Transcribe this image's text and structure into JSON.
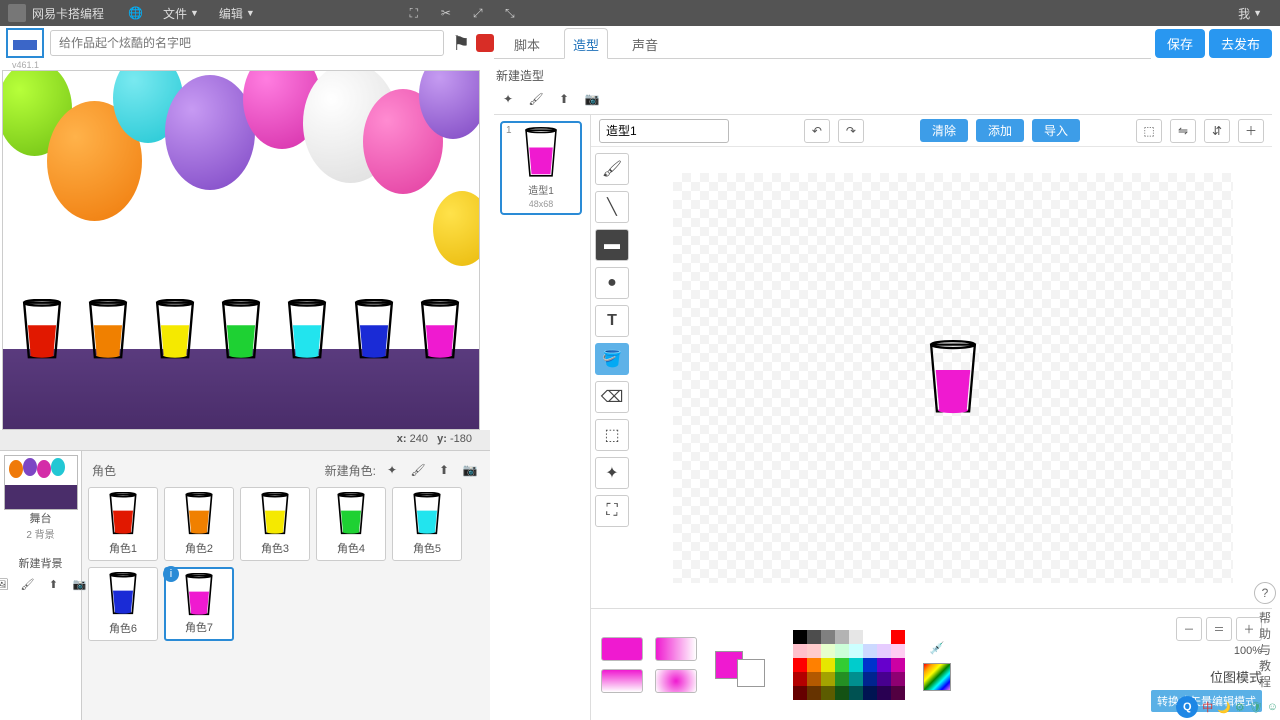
{
  "brand": "网易卡搭编程",
  "menus": {
    "file": "文件",
    "edit": "编辑",
    "me": "我"
  },
  "project_placeholder": "给作品起个炫酷的名字吧",
  "version": "v461.1",
  "tabs": {
    "scripts": "脚本",
    "costumes": "造型",
    "sounds": "声音"
  },
  "top_buttons": {
    "save": "保存",
    "publish": "去发布"
  },
  "coords": {
    "xlabel": "x:",
    "x": "240",
    "ylabel": "y:",
    "y": "-180"
  },
  "stage_col": {
    "stage": "舞台",
    "backdrops": "2 背景",
    "new_backdrop": "新建背景"
  },
  "sprite_pane": {
    "title": "角色",
    "new_sprite": "新建角色:"
  },
  "sprites": [
    {
      "name": "角色1",
      "color": "#e11800"
    },
    {
      "name": "角色2",
      "color": "#f08000"
    },
    {
      "name": "角色3",
      "color": "#f5e900"
    },
    {
      "name": "角色4",
      "color": "#1ed133"
    },
    {
      "name": "角色5",
      "color": "#22e4ee"
    },
    {
      "name": "角色6",
      "color": "#1a2bd6"
    },
    {
      "name": "角色7",
      "color": "#ef1ad0",
      "selected": true
    }
  ],
  "stage_cups": [
    "#e11800",
    "#f08000",
    "#f5e900",
    "#1ed133",
    "#22e4ee",
    "#1a2bd6",
    "#ef1ad0"
  ],
  "costume_panel": {
    "new_label": "新建造型",
    "thumb": {
      "num": "1",
      "name": "造型1",
      "size": "48x68"
    }
  },
  "paint": {
    "name_input": "造型1",
    "buttons": {
      "clear": "清除",
      "add": "添加",
      "import": "导入"
    },
    "zoom": "100%",
    "mode_label": "位图模式",
    "convert_label": "转换成矢量编辑模式",
    "current_color": "#ef1ad0"
  },
  "palette": [
    "#000000",
    "#4d4d4d",
    "#808080",
    "#b3b3b3",
    "#e6e6e6",
    "#ffffff",
    "#ffffff",
    "#ff0000",
    "#ffc0cb",
    "#ffcccc",
    "#e6ffcc",
    "#ccffd9",
    "#ccffff",
    "#ccd9ff",
    "#e6ccff",
    "#ffccf2",
    "#ff0000",
    "#ff8000",
    "#e6e600",
    "#33cc33",
    "#00cccc",
    "#0033cc",
    "#6600cc",
    "#cc00a3",
    "#b30000",
    "#b35900",
    "#a3a300",
    "#248f24",
    "#008f8f",
    "#00248f",
    "#47008f",
    "#8f0072",
    "#660000",
    "#663300",
    "#5c5c00",
    "#145214",
    "#005252",
    "#001452",
    "#290052",
    "#520041"
  ],
  "help": {
    "q": "?",
    "text": "帮助与教程"
  },
  "tray": {
    "ime": "中"
  }
}
